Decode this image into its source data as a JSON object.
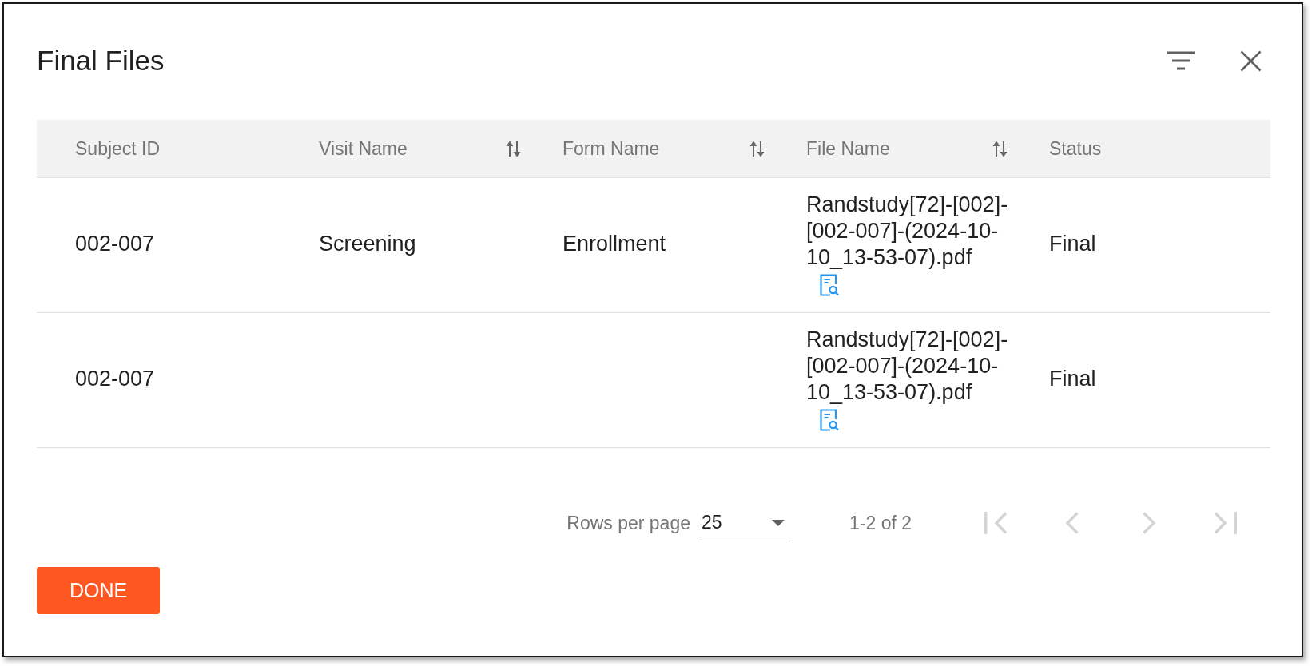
{
  "dialog": {
    "title": "Final Files"
  },
  "table": {
    "columns": [
      {
        "label": "Subject ID",
        "sortable": false
      },
      {
        "label": "Visit Name",
        "sortable": true
      },
      {
        "label": "Form Name",
        "sortable": true
      },
      {
        "label": "File Name",
        "sortable": true
      },
      {
        "label": "Status",
        "sortable": false
      }
    ],
    "rows": [
      {
        "subject_id": "002-007",
        "visit_name": "Screening",
        "form_name": "Enrollment",
        "file_name": "Randstudy[72]-[002]-[002-007]-(2024-10-10_13-53-07).pdf",
        "status": "Final"
      },
      {
        "subject_id": "002-007",
        "file_name": "Randstudy[72]-[002]-[002-007]-(2024-10-10_13-53-07).pdf",
        "status": "Final"
      }
    ]
  },
  "pagination": {
    "rows_per_page_label": "Rows per page",
    "rows_per_page": "25",
    "range": "1-2 of 2",
    "buttons": [
      {
        "kind": "first",
        "disabled": true
      },
      {
        "kind": "previous",
        "disabled": true
      },
      {
        "kind": "next",
        "disabled": true
      },
      {
        "kind": "last",
        "disabled": true
      }
    ]
  },
  "actions": [
    {
      "label": "DONE"
    }
  ]
}
